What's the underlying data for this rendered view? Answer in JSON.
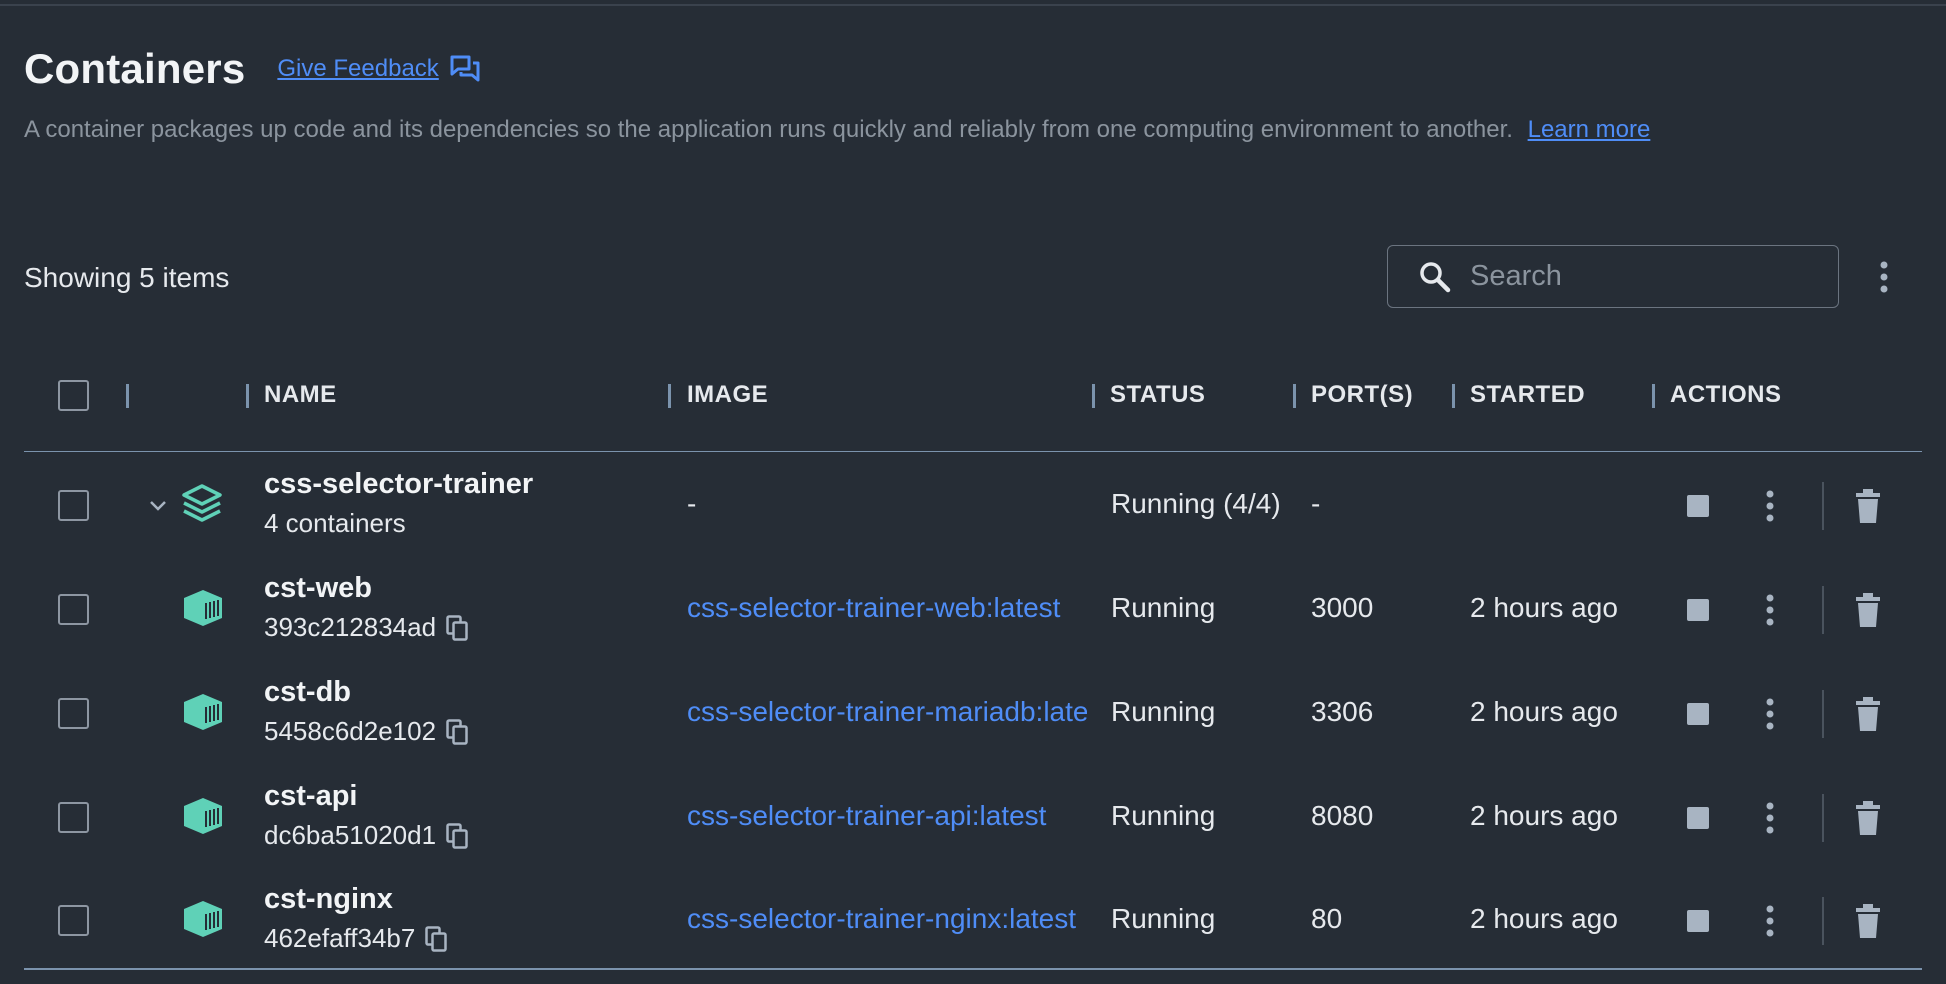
{
  "header": {
    "title": "Containers",
    "feedback_label": "Give Feedback",
    "description": "A container packages up code and its dependencies so the application runs quickly and reliably from one computing environment to another.",
    "learn_more": "Learn more"
  },
  "toolbar": {
    "showing": "Showing 5 items",
    "search_placeholder": "Search"
  },
  "columns": {
    "name": "NAME",
    "image": "IMAGE",
    "status": "STATUS",
    "ports": "PORT(S)",
    "started": "STARTED",
    "actions": "ACTIONS"
  },
  "rows": [
    {
      "name": "css-selector-trainer",
      "sub": "4 containers",
      "image": "-",
      "status": "Running (4/4)",
      "ports": "-",
      "started": ""
    },
    {
      "name": "cst-web",
      "sub": "393c212834ad",
      "image": "css-selector-trainer-web:latest",
      "status": "Running",
      "ports": "3000",
      "started": "2 hours ago"
    },
    {
      "name": "cst-db",
      "sub": "5458c6d2e102",
      "image": "css-selector-trainer-mariadb:latest",
      "status": "Running",
      "ports": "3306",
      "started": "2 hours ago"
    },
    {
      "name": "cst-api",
      "sub": "dc6ba51020d1",
      "image": "css-selector-trainer-api:latest",
      "status": "Running",
      "ports": "8080",
      "started": "2 hours ago"
    },
    {
      "name": "cst-nginx",
      "sub": "462efaff34b7",
      "image": "css-selector-trainer-nginx:latest",
      "status": "Running",
      "ports": "80",
      "started": "2 hours ago"
    }
  ],
  "colors": {
    "background": "#262d36",
    "link": "#4f8df7",
    "icon_teal": "#5fd1b7",
    "separator": "#7b93ad"
  }
}
